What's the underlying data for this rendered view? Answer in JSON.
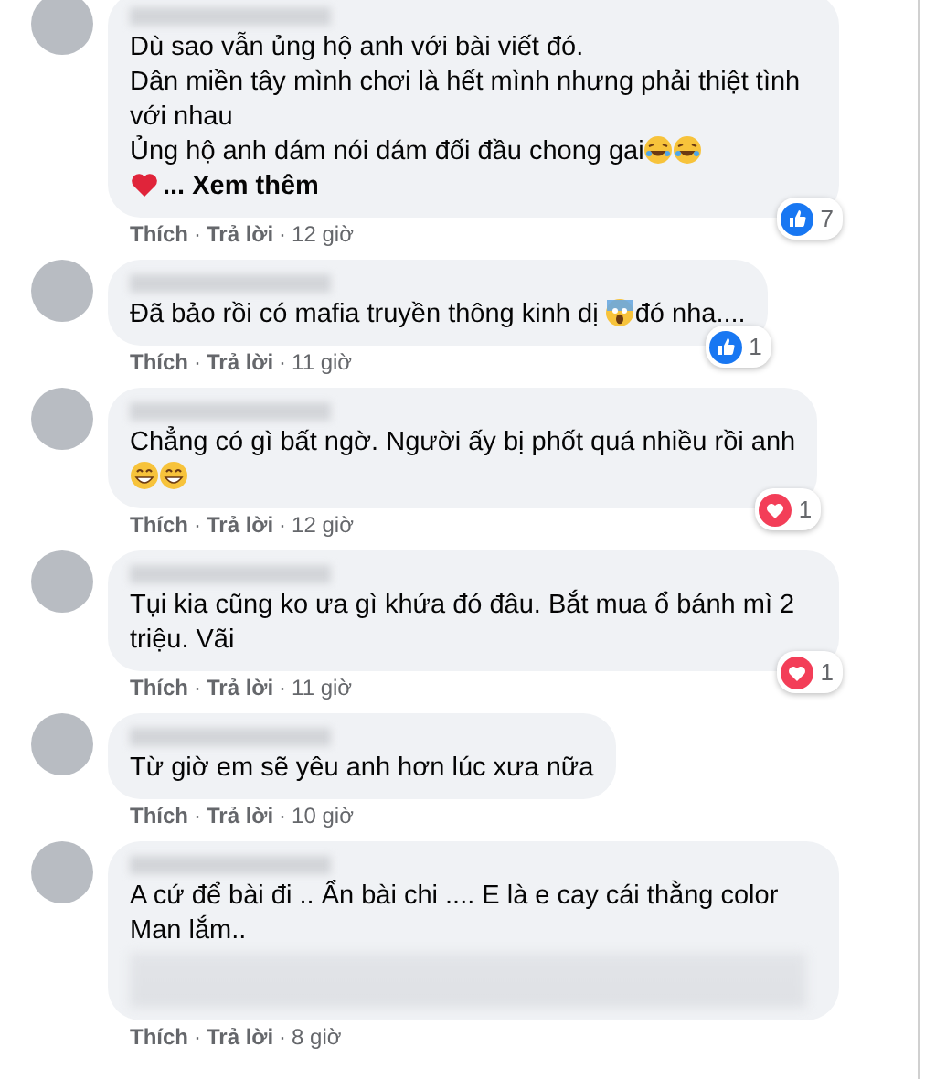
{
  "comments": [
    {
      "lines": [
        [
          {
            "kind": "text",
            "text": "Dù sao vẫn ủng hộ anh với bài viết đó."
          }
        ],
        [
          {
            "kind": "text",
            "text": "Dân miền tây mình chơi là hết mình nhưng phải thiệt tình với nhau"
          }
        ],
        [
          {
            "kind": "text",
            "text": "Ủng hộ anh dám nói dám đối đầu chong gai"
          },
          {
            "kind": "laugh"
          },
          {
            "kind": "laugh"
          }
        ],
        [
          {
            "kind": "heart"
          },
          {
            "kind": "link",
            "text": "... Xem thêm"
          }
        ]
      ],
      "reaction": {
        "kind": "like",
        "count": "7"
      },
      "footer": {
        "like": "Thích",
        "sep": "·",
        "reply": "Trả lời",
        "time": "12 giờ"
      }
    },
    {
      "lines": [
        [
          {
            "kind": "text",
            "text": "Đã bảo rồi có mafia truyền thông kinh dị "
          },
          {
            "kind": "scream"
          },
          {
            "kind": "text",
            "text": "đó nha...."
          }
        ]
      ],
      "reaction": {
        "kind": "like",
        "count": "1"
      },
      "footer": {
        "like": "Thích",
        "sep": "·",
        "reply": "Trả lời",
        "time": "11 giờ"
      }
    },
    {
      "lines": [
        [
          {
            "kind": "text",
            "text": "Chẳng có gì bất ngờ. Người ấy bị phốt quá nhiều rồi anh"
          }
        ],
        [
          {
            "kind": "grin"
          },
          {
            "kind": "grin"
          }
        ]
      ],
      "reaction": {
        "kind": "love",
        "count": "1"
      },
      "footer": {
        "like": "Thích",
        "sep": "·",
        "reply": "Trả lời",
        "time": "12 giờ"
      }
    },
    {
      "lines": [
        [
          {
            "kind": "text",
            "text": "Tụi kia cũng ko ưa gì khứa đó đâu. Bắt mua ổ bánh mì 2 triệu. Vãi"
          }
        ]
      ],
      "reaction": {
        "kind": "love",
        "count": "1"
      },
      "footer": {
        "like": "Thích",
        "sep": "·",
        "reply": "Trả lời",
        "time": "11 giờ"
      }
    },
    {
      "lines": [
        [
          {
            "kind": "text",
            "text": "Từ giờ em sẽ yêu anh hơn lúc xưa nữa"
          }
        ]
      ],
      "footer": {
        "like": "Thích",
        "sep": "·",
        "reply": "Trả lời",
        "time": "10 giờ"
      }
    },
    {
      "lines": [
        [
          {
            "kind": "text",
            "text": "A cứ để bài đi .. Ẩn bài chi .... E là e cay cái thằng color Man lắm.."
          }
        ]
      ],
      "has_blurred_text": true,
      "footer": {
        "like": "Thích",
        "sep": "·",
        "reply": "Trả lời",
        "time": "8 giờ"
      }
    }
  ]
}
